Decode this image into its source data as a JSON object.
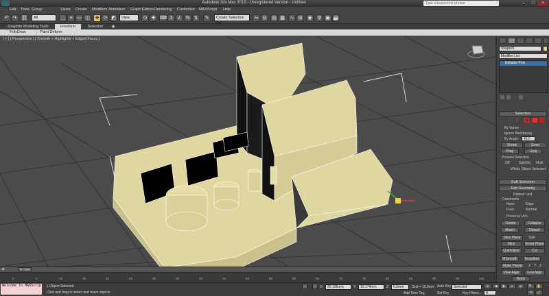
{
  "app": {
    "title": "Autodesk 3ds Max 2013 - Unregistered Version - Untitled",
    "search_placeholder": "Type a keyword or phrase"
  },
  "menu": [
    "Edit",
    "Tools",
    "Group",
    "Views",
    "Create",
    "Modifiers",
    "Animation",
    "Graph Editors",
    "Rendering",
    "Customize",
    "MAXScript",
    "Help"
  ],
  "toolbar": {
    "selection_filter": "All",
    "view_dropdown": "View",
    "named_selection": "Create Selection Set"
  },
  "ribbon": {
    "tabs": [
      "Graphite Modeling Tools",
      "Freeform",
      "Selection"
    ],
    "subtabs": [
      "PolyDraw",
      "Paint Deform"
    ]
  },
  "viewport": {
    "label": "[ + ] [ Perspective ] [ Smooth + Highlights + Edged Faces ]"
  },
  "panel": {
    "object_name": "Shape01",
    "modifier_list": "Modifier List",
    "stack_item": "Editable Poly",
    "selection": {
      "title": "Selection",
      "by_vertex": "By Vertex",
      "ignore_backfacing": "Ignore Backfacing",
      "by_angle": "By Angle:",
      "angle_value": "45.0",
      "shrink": "Shrink",
      "grow": "Grow",
      "ring": "Ring",
      "loop": "Loop",
      "preview_title": "Preview Selection",
      "preview_off": "Off",
      "preview_subobj": "SubObj",
      "preview_multi": "Multi",
      "whole_object": "Whole Object Selected"
    },
    "soft_selection": "Soft Selection",
    "edit_geometry": {
      "title": "Edit Geometry",
      "repeat_last": "Repeat Last",
      "constraints": "Constraints",
      "none": "None",
      "edge": "Edge",
      "face": "Face",
      "normal": "Normal",
      "preserve_uvs": "Preserve UVs",
      "create": "Create",
      "collapse": "Collapse",
      "attach": "Attach",
      "detach": "Detach",
      "slice_plane": "Slice Plane",
      "split": "Split",
      "slice": "Slice",
      "reset_plane": "Reset Plane",
      "quickslice": "QuickSlice",
      "cut": "Cut",
      "msmooth": "MSmooth",
      "tessellate": "Tessellate",
      "make_planar": "Make Planar",
      "view_align": "View Align",
      "grid_align": "Grid Align",
      "relax": "Relax",
      "xyz": [
        "X",
        "Y",
        "Z"
      ]
    }
  },
  "timeline": {
    "frame": "0 / 100",
    "ticks": [
      "0",
      "5",
      "10",
      "15",
      "20",
      "25",
      "30",
      "35",
      "40",
      "45",
      "50",
      "55",
      "60",
      "65",
      "70",
      "75",
      "80",
      "85",
      "90",
      "95",
      "100"
    ]
  },
  "status": {
    "maxscript": "Welcome to MAXScrip",
    "objects_selected": "1 Object Selected",
    "prompt": "Click and drag to select and move objects",
    "x_label": "X:",
    "x_value": "20,126mm",
    "y_label": "Y:",
    "y_value": "10,174mm",
    "z_label": "Z:",
    "z_value": "0,0mm",
    "grid": "Grid = 10,0mm",
    "auto_time_tag": "Add Time Tag",
    "auto_key": "Auto Key",
    "selected": "Selected",
    "set_key": "Set Key",
    "key_filters": "Key Filters...",
    "frame_value": "0"
  },
  "colors": {
    "object": "#e0d7a0",
    "viewport": "#4b4b4b",
    "accent": "#3b6ea5"
  }
}
